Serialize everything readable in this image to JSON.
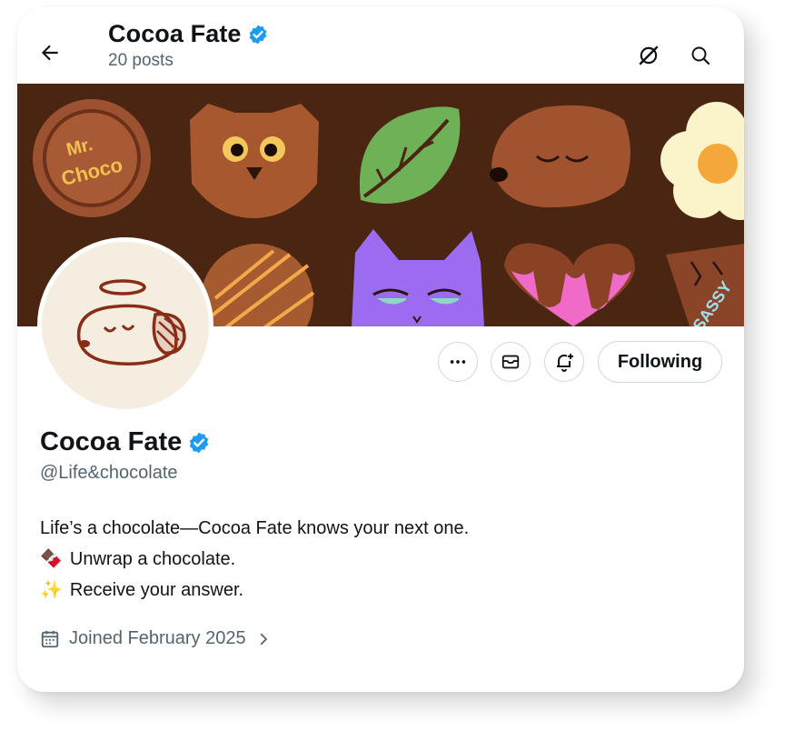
{
  "header": {
    "name": "Cocoa Fate",
    "posts_count": "20 posts"
  },
  "banner": {
    "choco_label_line1": "Mr.",
    "choco_label_line2": "Choco",
    "sassy_label": "SASSY"
  },
  "profile": {
    "name": "Cocoa Fate",
    "handle": "@Life&chocolate",
    "bio": {
      "line1": "Life’s a chocolate—Cocoa Fate knows your next one.",
      "line2_emoji": "🍫",
      "line2": "Unwrap a chocolate.",
      "line3_emoji": "✨",
      "line3": "Receive your answer."
    },
    "joined": "Joined February 2025"
  },
  "actions": {
    "following_label": "Following"
  },
  "colors": {
    "verified": "#1d9bf0",
    "banner_bg": "#4a2511",
    "secondary_text": "#536471",
    "border": "#cfd9de"
  }
}
